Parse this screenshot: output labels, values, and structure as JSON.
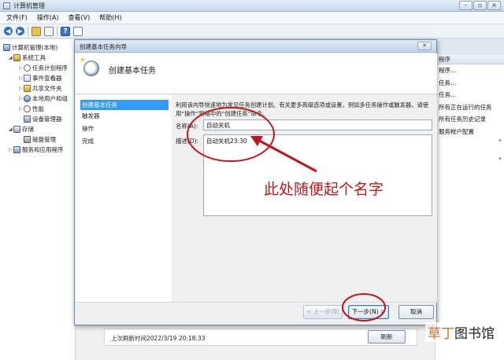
{
  "window": {
    "title": "计算机管理"
  },
  "menu": [
    "文件(F)",
    "操作(A)",
    "查看(V)",
    "帮助(H)"
  ],
  "tree": [
    {
      "label": "计算机管理(本地)",
      "level": 0,
      "icon": "computer-icon"
    },
    {
      "label": "系统工具",
      "level": 1,
      "icon": "tools-icon"
    },
    {
      "label": "任务计划程序",
      "level": 2,
      "icon": "clock-icon"
    },
    {
      "label": "事件查看器",
      "level": 2,
      "icon": "event-icon"
    },
    {
      "label": "共享文件夹",
      "level": 2,
      "icon": "share-icon"
    },
    {
      "label": "本地用户和组",
      "level": 2,
      "icon": "users-icon"
    },
    {
      "label": "性能",
      "level": 2,
      "icon": "performance-icon"
    },
    {
      "label": "设备管理器",
      "level": 2,
      "icon": "device-icon"
    },
    {
      "label": "存储",
      "level": 1,
      "icon": "storage-icon"
    },
    {
      "label": "磁盘管理",
      "level": 2,
      "icon": "disk-icon"
    },
    {
      "label": "服务和应用程序",
      "level": 1,
      "icon": "services-icon"
    }
  ],
  "actions": {
    "header": "程序",
    "items": [
      "程序...",
      "任务...",
      "任务...",
      "所有正在运行的任务",
      "所有任务历史记录",
      "服务帐户配置"
    ]
  },
  "wizard": {
    "title": "创建基本任务向导",
    "header_title": "创建基本任务",
    "steps": [
      "创建基本任务",
      "触发器",
      "操作",
      "完成"
    ],
    "active_step": 0,
    "intro": "利用该向导快速地为常见任务创建计划。有关更多高级选项或设置，例如多任务操作或触发器，请使用“操作”窗格中的“创建任务”命令。",
    "name_label": "名称(A):",
    "name_value": "自动关机",
    "desc_label": "描述(D):",
    "desc_value": "自动关机23:30",
    "back_label": "< 上一步(B)",
    "next_label": "下一步(N) >",
    "cancel_label": "取消"
  },
  "bottom": {
    "last_refresh": "上次刷新时间2022/3/19 20:18:33",
    "refresh_label": "刷新"
  },
  "annotation": {
    "text": "此处随便起个名字",
    "color": "#c0161c"
  },
  "watermark": {
    "part1": "草丁",
    "part2": "图书馆"
  }
}
